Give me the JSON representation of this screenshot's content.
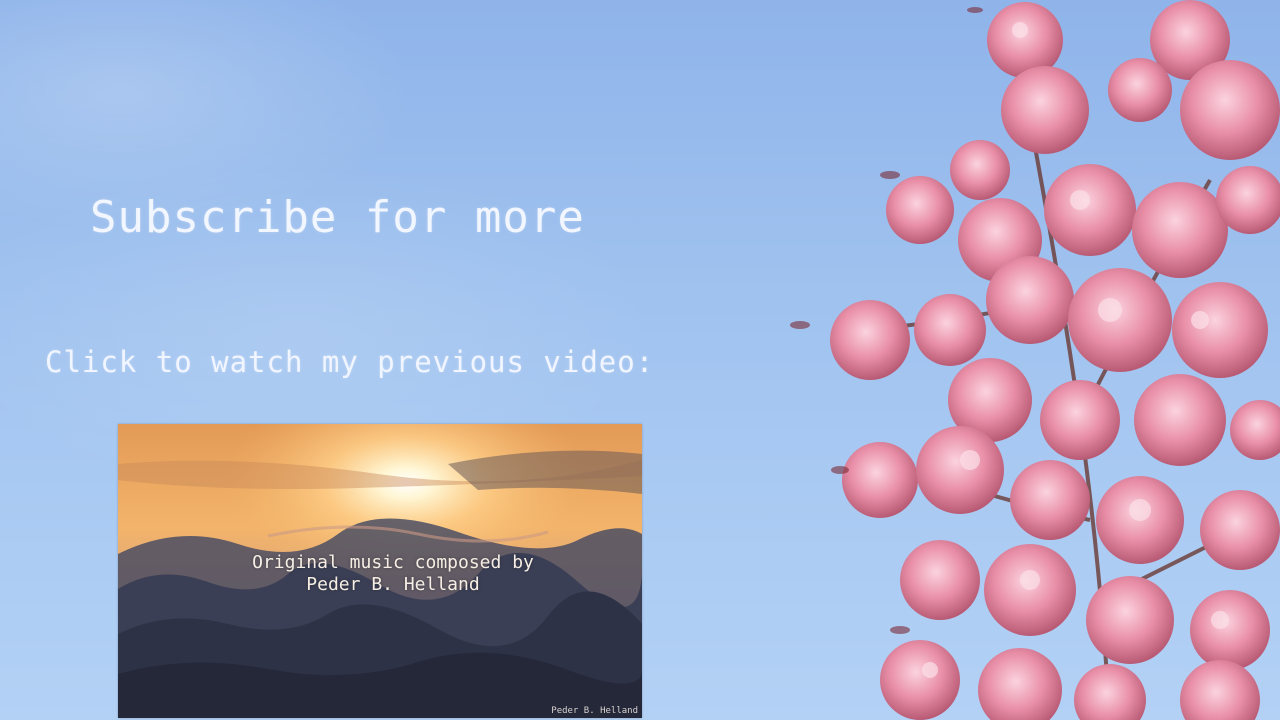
{
  "endscreen": {
    "headline": "Subscribe for more",
    "subline": "Click to watch my previous video:"
  },
  "video_card": {
    "caption_line_1": "Original music composed by",
    "caption_line_2": "Peder B. Helland",
    "credit": "Peder B. Helland"
  },
  "colors": {
    "sky": "#9dc0ee",
    "text": "#f2f6ff",
    "blossom": "#e98fa8",
    "sunset": "#f0a85c"
  }
}
